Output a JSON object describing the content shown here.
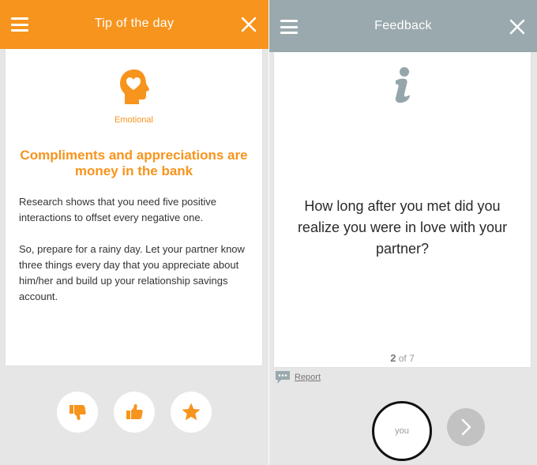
{
  "colors": {
    "accent_orange": "#f7941d",
    "feedback_bar": "#9aa9ad",
    "panel_bg": "#e6e6e6"
  },
  "tip_screen": {
    "title": "Tip of the day",
    "menu_icon": "hamburger-menu-icon",
    "close_icon": "close-icon",
    "category": {
      "icon": "head-heart-icon",
      "label": "Emotional"
    },
    "heading": "Compliments and appreciations are money in the bank",
    "paragraphs": [
      "Research shows that you need five positive interactions to offset every negative one.",
      "So, prepare for a rainy day. Let your partner know three things every day that you appreciate about him/her and build up your relationship savings account."
    ],
    "actions": [
      {
        "icon": "thumbs-down-icon"
      },
      {
        "icon": "thumbs-up-icon"
      },
      {
        "icon": "star-icon"
      }
    ]
  },
  "feedback_screen": {
    "title": "Feedback",
    "menu_icon": "hamburger-menu-icon",
    "close_icon": "close-icon",
    "info_icon": "info-icon",
    "question": "How long after you met did you realize you were in love with your partner?",
    "pager": {
      "current": "2",
      "separator": " of ",
      "total": "7"
    },
    "report": {
      "icon": "speech-bubble-icon",
      "label": "Report"
    },
    "answer_button_label": "you",
    "next_icon": "chevron-right-icon"
  }
}
